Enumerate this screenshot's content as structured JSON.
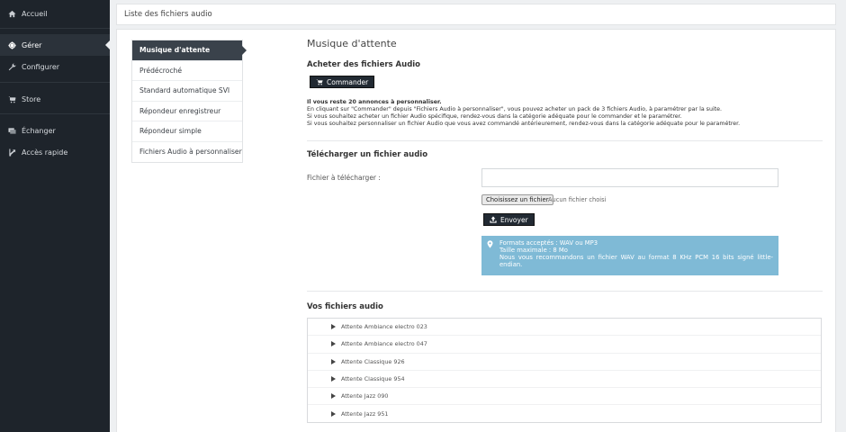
{
  "sidebar": {
    "items": [
      {
        "label": "Accueil",
        "icon": "home-icon"
      },
      {
        "label": "Gérer",
        "icon": "gear-icon"
      },
      {
        "label": "Configurer",
        "icon": "wrench-icon"
      },
      {
        "label": "Store",
        "icon": "cart-icon"
      },
      {
        "label": "Échanger",
        "icon": "exchange-icon"
      },
      {
        "label": "Accès rapide",
        "icon": "shortcut-icon"
      }
    ]
  },
  "topbar": {
    "title": "Liste des fichiers audio"
  },
  "submenu": {
    "items": [
      "Musique d'attente",
      "Prédécroché",
      "Standard automatique SVI",
      "Répondeur enregistreur",
      "Répondeur simple",
      "Fichiers Audio à personnaliser"
    ]
  },
  "content": {
    "page_title": "Musique d'attente",
    "buy_title": "Acheter des fichiers Audio",
    "order_button": "Commander",
    "remaining": "Il vous reste 20 annonces à personnaliser.",
    "info_lines": [
      "En cliquant sur \"Commander\" depuis \"Fichiers Audio à personnaliser\", vous pouvez acheter un pack de 3 fichiers Audio, à paramétrer par la suite.",
      "Si vous souhaitez acheter un fichier Audio spécifique, rendez-vous dans la catégorie adéquate pour le commander et le paramétrer.",
      "Si vous souhaitez personnaliser un fichier Audio que vous avez commandé antérieurement, rendez-vous dans la catégorie adéquate pour le paramétrer."
    ],
    "upload_title": "Télécharger un fichier audio",
    "file_label": "Fichier à télécharger :",
    "file_input_value": "",
    "choose_file": "Choisissez un fichier",
    "no_file": "Aucun fichier choisi",
    "send_button": "Envoyer",
    "alert": {
      "formats": "Formats acceptés : WAV ou MP3",
      "max_size": "Taille maximale : 8 Mo",
      "recommend": "Nous vous recommandons un fichier WAV au format 8 KHz PCM 16 bits signé little-endian."
    },
    "files_title": "Vos fichiers audio",
    "files": [
      "Attente Ambiance electro 023",
      "Attente Ambiance electro 047",
      "Attente Classique 926",
      "Attente Classique 954",
      "Attente Jazz 090",
      "Attente Jazz 951"
    ]
  }
}
